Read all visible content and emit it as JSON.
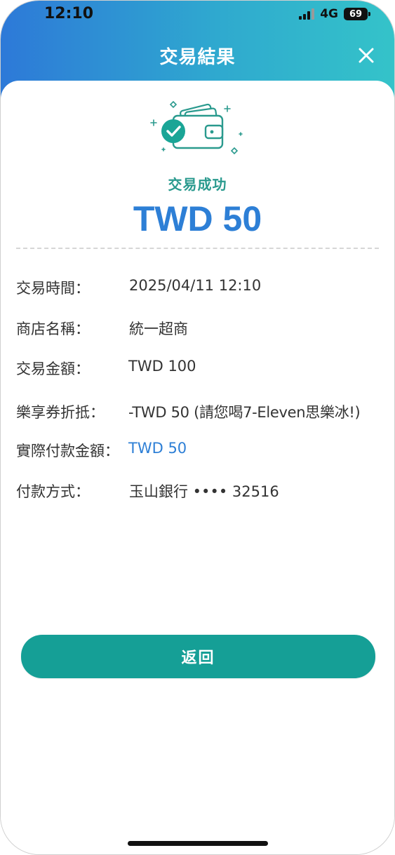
{
  "status_bar": {
    "time": "12:10",
    "network": "4G",
    "battery": "69",
    "icons": [
      "signal-icon",
      "battery-icon"
    ]
  },
  "header": {
    "title": "交易結果",
    "close_icon": "close-icon"
  },
  "result": {
    "illustration_icon": "wallet-check-icon",
    "status": "交易成功",
    "amount": "TWD 50"
  },
  "details": [
    {
      "label": "交易時間：",
      "value": "2025/04/11 12:10",
      "highlight": false
    },
    {
      "label": "商店名稱：",
      "value": "統一超商",
      "highlight": false
    },
    {
      "label": "交易金額：",
      "value": "TWD 100",
      "highlight": false
    },
    {
      "label": "樂享券折抵：",
      "value": "-TWD 50 (請您喝7-Eleven思樂冰!)",
      "highlight": false
    },
    {
      "label": "實際付款金額：",
      "value": "TWD 50",
      "highlight": true
    },
    {
      "label": "付款方式：",
      "value": "玉山銀行 •••• 32516",
      "highlight": false
    }
  ],
  "actions": {
    "back_label": "返回"
  },
  "colors": {
    "header_gradient_start": "#2d79d8",
    "header_gradient_end": "#34c3c9",
    "success_teal": "#2a9a8e",
    "amount_blue": "#2d7fd6",
    "button_teal": "#159f96"
  }
}
